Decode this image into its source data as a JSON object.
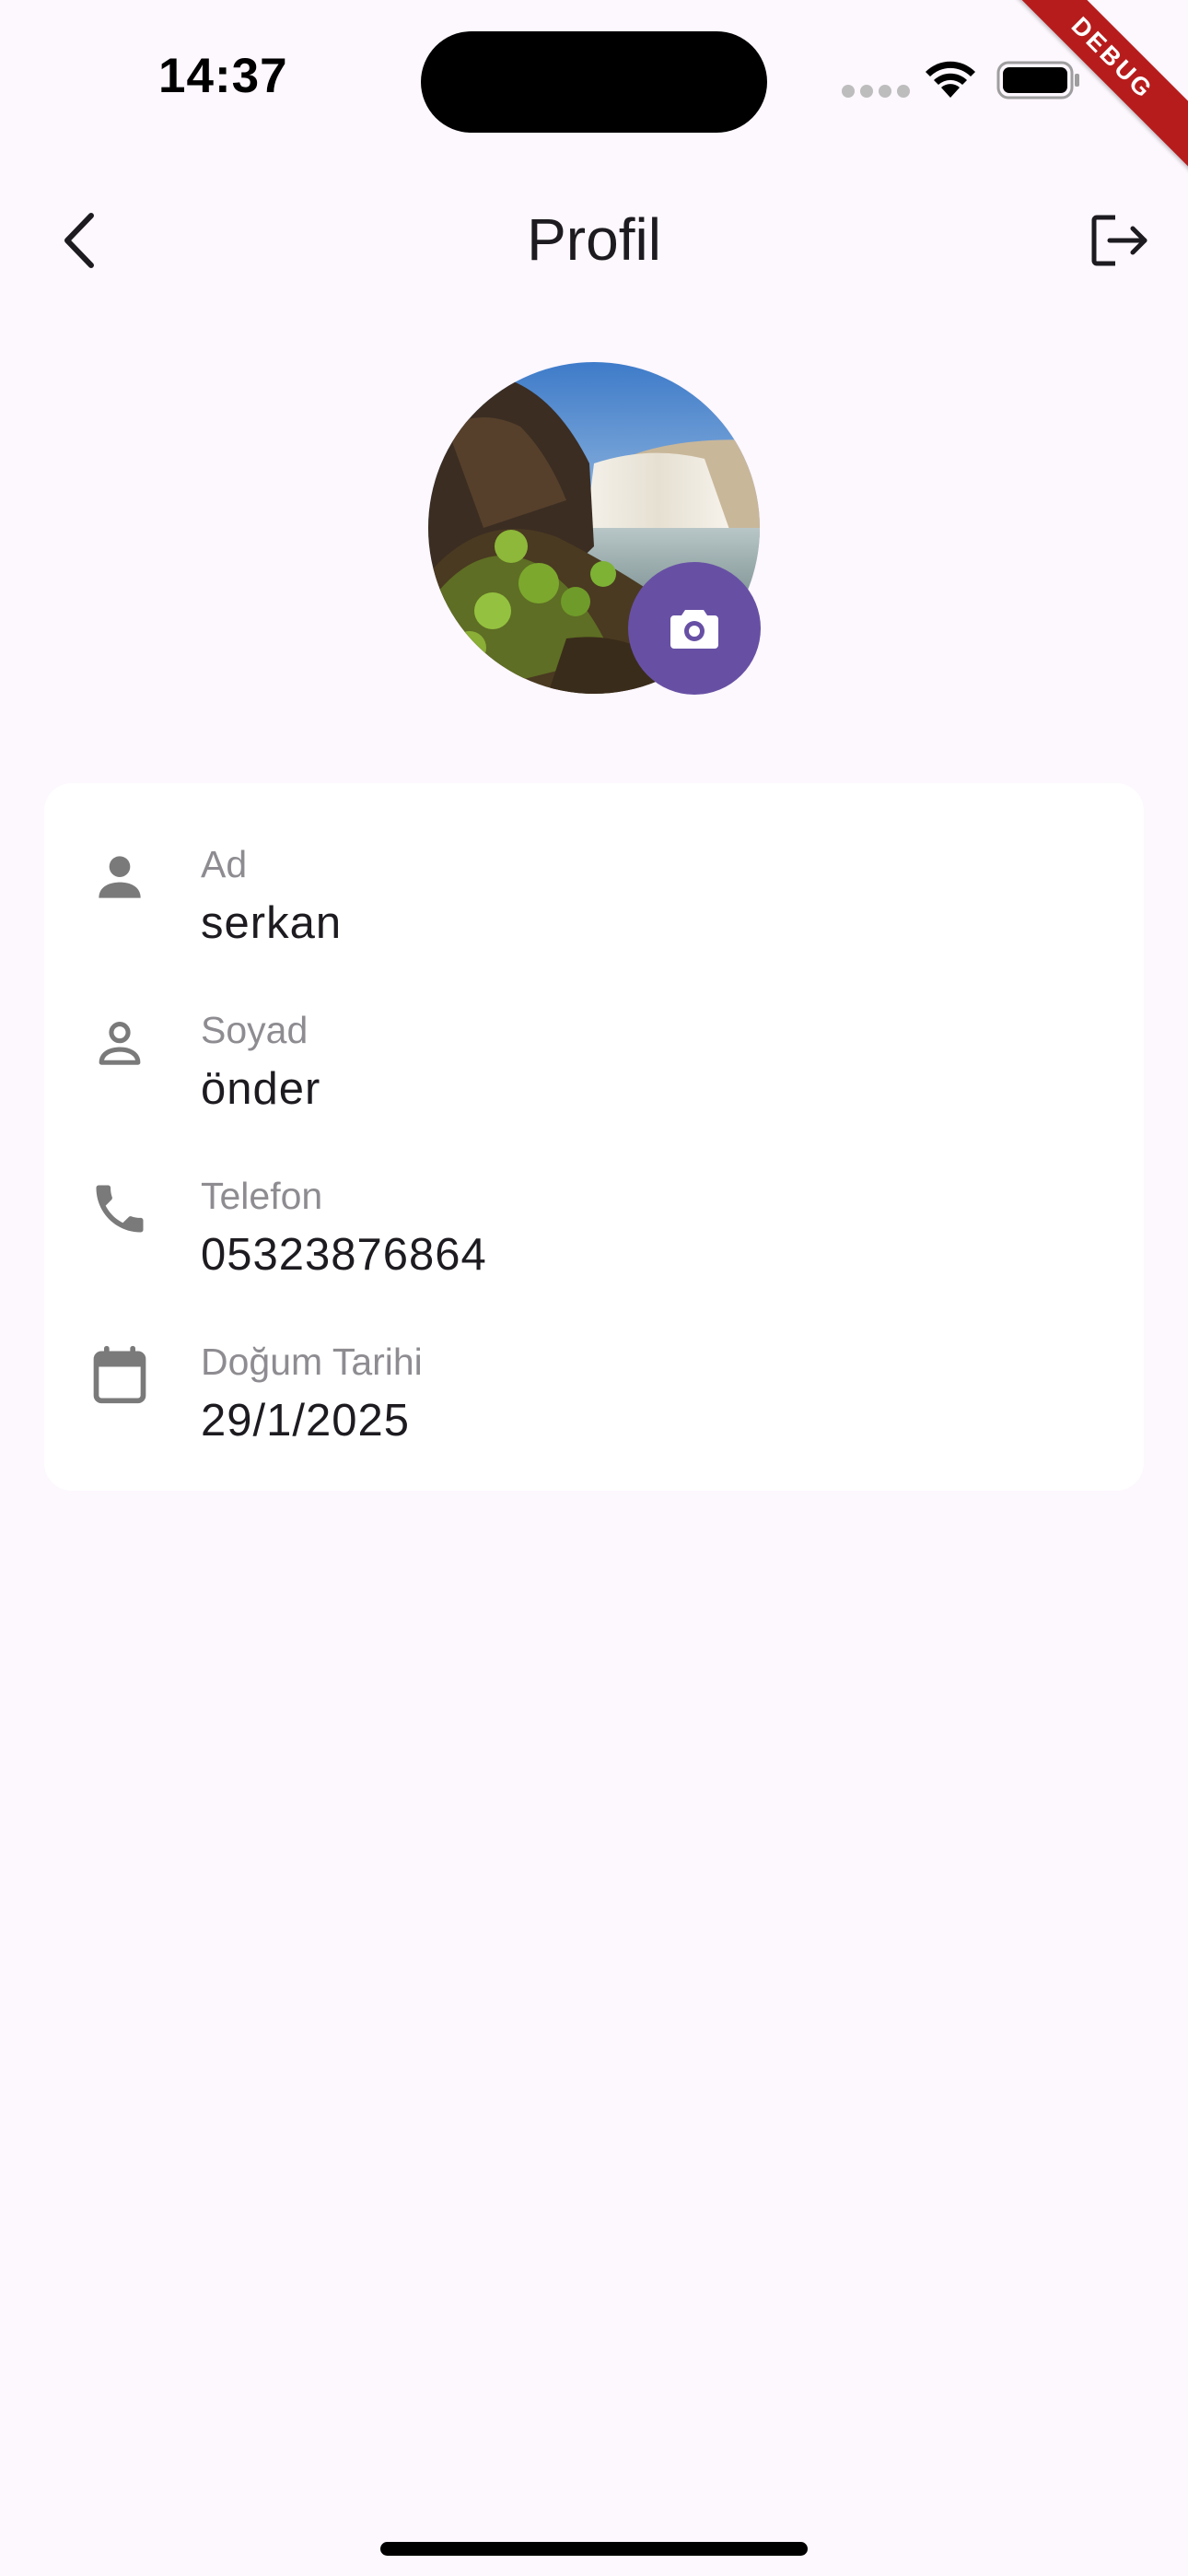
{
  "status_bar": {
    "time": "14:37"
  },
  "debug_banner": "DEBUG",
  "app_bar": {
    "title": "Profil",
    "back_icon": "chevron-left-icon",
    "logout_icon": "logout-icon"
  },
  "avatar": {
    "image": "waterfall-landscape",
    "camera_icon": "camera-icon"
  },
  "profile_fields": [
    {
      "icon": "person-icon",
      "label": "Ad",
      "value": "serkan"
    },
    {
      "icon": "person-outline-icon",
      "label": "Soyad",
      "value": "önder"
    },
    {
      "icon": "phone-icon",
      "label": "Telefon",
      "value": "05323876864"
    },
    {
      "icon": "calendar-icon",
      "label": "Doğum Tarihi",
      "value": "29/1/2025"
    }
  ],
  "colors": {
    "background": "#FDF7FE",
    "card": "#FFFFFF",
    "accent": "#6750A4",
    "label": "#8E8C91",
    "text": "#1D1B20",
    "icon": "#7A7A7A"
  }
}
